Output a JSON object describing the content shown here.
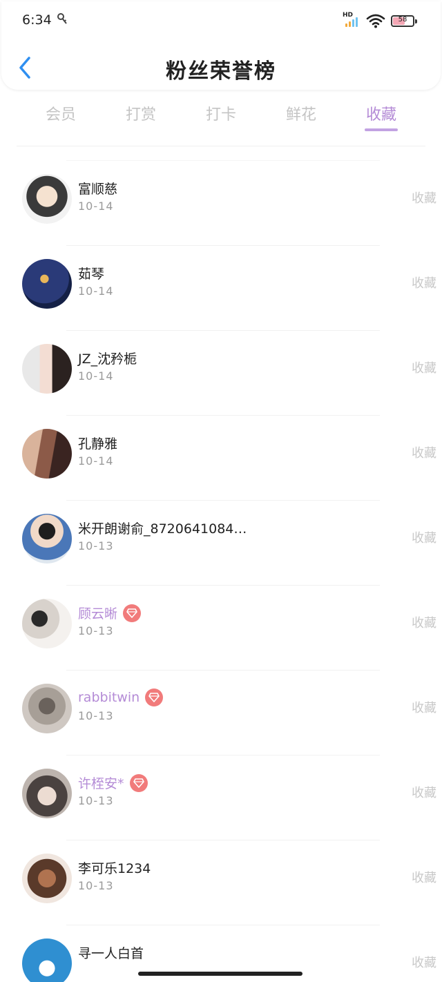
{
  "status_bar": {
    "time": "6:34",
    "signal_label": "HD",
    "battery_level": "58"
  },
  "header": {
    "title": "粉丝荣誉榜",
    "back_icon": "chevron-left-icon"
  },
  "tabs": [
    {
      "label": "会员",
      "active": false
    },
    {
      "label": "打赏",
      "active": false
    },
    {
      "label": "打卡",
      "active": false
    },
    {
      "label": "鲜花",
      "active": false
    },
    {
      "label": "收藏",
      "active": true
    }
  ],
  "colors": {
    "accent": "#b48bd6",
    "tab_inactive": "#c4c4c4",
    "gem_badge": "#f17b7b",
    "back_arrow": "#2f8ff0"
  },
  "fans": [
    {
      "name": "富顺慈",
      "date": "10-14",
      "action": "收藏",
      "vip": false
    },
    {
      "name": "茹琴",
      "date": "10-14",
      "action": "收藏",
      "vip": false
    },
    {
      "name": "JZ_沈矜栀",
      "date": "10-14",
      "action": "收藏",
      "vip": false
    },
    {
      "name": "孔静雅",
      "date": "10-14",
      "action": "收藏",
      "vip": false
    },
    {
      "name": "米开朗谢俞_8720641084…",
      "date": "10-13",
      "action": "收藏",
      "vip": false
    },
    {
      "name": "顾云晰",
      "date": "10-13",
      "action": "收藏",
      "vip": true
    },
    {
      "name": "rabbitwin",
      "date": "10-13",
      "action": "收藏",
      "vip": true
    },
    {
      "name": "许桎安*",
      "date": "10-13",
      "action": "收藏",
      "vip": true
    },
    {
      "name": "李可乐1234",
      "date": "10-13",
      "action": "收藏",
      "vip": false
    },
    {
      "name": "寻一人白首",
      "date": "",
      "action": "收藏",
      "vip": false
    }
  ]
}
